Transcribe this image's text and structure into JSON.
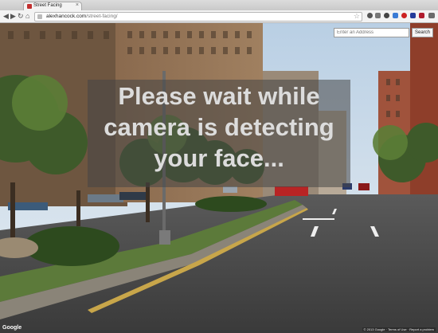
{
  "tab": {
    "title": "Street Facing",
    "close": "×"
  },
  "toolbar": {
    "back": "◀",
    "forward": "▶",
    "reload": "↻",
    "home": "⌂",
    "star": "☆"
  },
  "address": {
    "domain": "alexhancock.com",
    "path": "/street-facing/"
  },
  "message": {
    "line1": "Please wait while",
    "line2": "camera is detecting",
    "line3": "your face..."
  },
  "search": {
    "placeholder": "Enter an Address",
    "button_label": "Search"
  },
  "map": {
    "logo": "Google",
    "footer": "© 2013 Google · Terms of Use · Report a problem"
  }
}
